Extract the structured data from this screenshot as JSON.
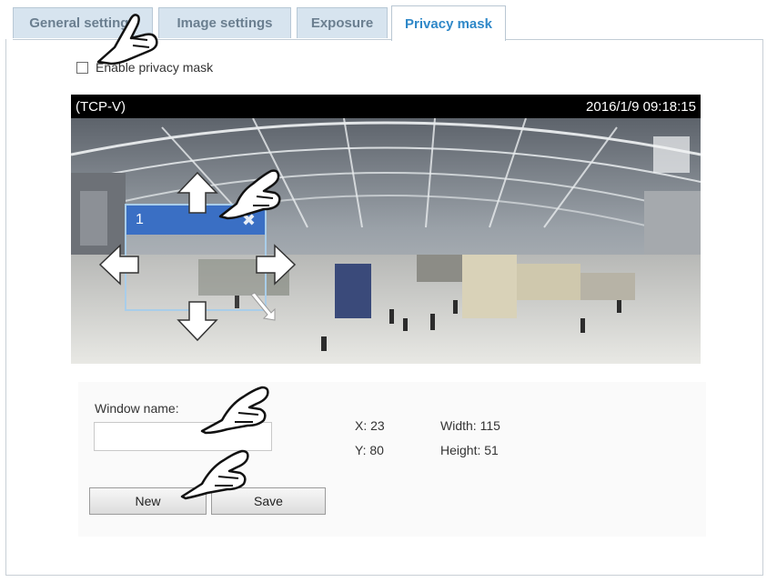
{
  "tabs": [
    {
      "label": "General settings",
      "active": false
    },
    {
      "label": "Image settings",
      "active": false
    },
    {
      "label": "Exposure",
      "active": false
    },
    {
      "label": "Privacy mask",
      "active": true
    }
  ],
  "enable_privacy_mask": {
    "label": "Enable privacy mask",
    "checked": false
  },
  "viewer": {
    "stream_label": "(TCP-V)",
    "timestamp": "2016/1/9 09:18:15"
  },
  "mask_window": {
    "name": "1",
    "close_glyph": "✖"
  },
  "form": {
    "window_name_label": "Window name:",
    "window_name_value": "",
    "x_label": "X: 23",
    "y_label": "Y: 80",
    "width_label": "Width: 115",
    "height_label": "Height: 51",
    "new_button": "New",
    "save_button": "Save"
  },
  "colors": {
    "tab_active_text": "#2f88c8",
    "mask_header": "#3a6fc4",
    "mask_border": "#a9cde9"
  },
  "icons": [
    "pointing-hand-icon",
    "move-arrow-icon",
    "close-icon",
    "resize-arrow-icon"
  ]
}
